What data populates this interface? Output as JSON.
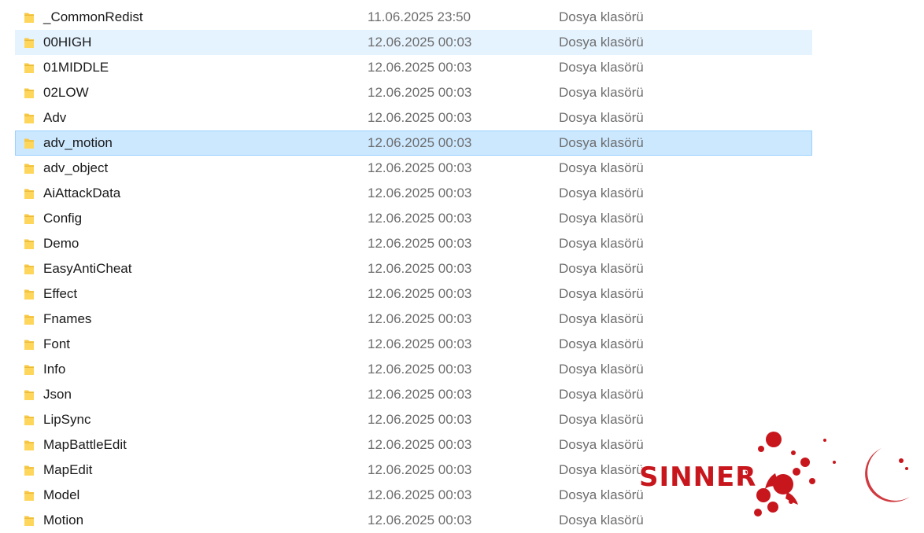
{
  "rows": [
    {
      "name": "_CommonRedist",
      "date": "11.06.2025 23:50",
      "type": "Dosya klasörü",
      "state": ""
    },
    {
      "name": "00HIGH",
      "date": "12.06.2025 00:03",
      "type": "Dosya klasörü",
      "state": "hover"
    },
    {
      "name": "01MIDDLE",
      "date": "12.06.2025 00:03",
      "type": "Dosya klasörü",
      "state": ""
    },
    {
      "name": "02LOW",
      "date": "12.06.2025 00:03",
      "type": "Dosya klasörü",
      "state": ""
    },
    {
      "name": "Adv",
      "date": "12.06.2025 00:03",
      "type": "Dosya klasörü",
      "state": ""
    },
    {
      "name": "adv_motion",
      "date": "12.06.2025 00:03",
      "type": "Dosya klasörü",
      "state": "selected"
    },
    {
      "name": "adv_object",
      "date": "12.06.2025 00:03",
      "type": "Dosya klasörü",
      "state": ""
    },
    {
      "name": "AiAttackData",
      "date": "12.06.2025 00:03",
      "type": "Dosya klasörü",
      "state": ""
    },
    {
      "name": "Config",
      "date": "12.06.2025 00:03",
      "type": "Dosya klasörü",
      "state": ""
    },
    {
      "name": "Demo",
      "date": "12.06.2025 00:03",
      "type": "Dosya klasörü",
      "state": ""
    },
    {
      "name": "EasyAntiCheat",
      "date": "12.06.2025 00:03",
      "type": "Dosya klasörü",
      "state": ""
    },
    {
      "name": "Effect",
      "date": "12.06.2025 00:03",
      "type": "Dosya klasörü",
      "state": ""
    },
    {
      "name": "Fnames",
      "date": "12.06.2025 00:03",
      "type": "Dosya klasörü",
      "state": ""
    },
    {
      "name": "Font",
      "date": "12.06.2025 00:03",
      "type": "Dosya klasörü",
      "state": ""
    },
    {
      "name": "Info",
      "date": "12.06.2025 00:03",
      "type": "Dosya klasörü",
      "state": ""
    },
    {
      "name": "Json",
      "date": "12.06.2025 00:03",
      "type": "Dosya klasörü",
      "state": ""
    },
    {
      "name": "LipSync",
      "date": "12.06.2025 00:03",
      "type": "Dosya klasörü",
      "state": ""
    },
    {
      "name": "MapBattleEdit",
      "date": "12.06.2025 00:03",
      "type": "Dosya klasörü",
      "state": ""
    },
    {
      "name": "MapEdit",
      "date": "12.06.2025 00:03",
      "type": "Dosya klasörü",
      "state": ""
    },
    {
      "name": "Model",
      "date": "12.06.2025 00:03",
      "type": "Dosya klasörü",
      "state": ""
    },
    {
      "name": "Motion",
      "date": "12.06.2025 00:03",
      "type": "Dosya klasörü",
      "state": ""
    }
  ],
  "icons": {
    "folder": "folder-icon"
  },
  "colors": {
    "selected_bg": "#cce8ff",
    "selected_border": "#99d1ff",
    "hover_bg": "#e5f3ff",
    "folder_yellow": "#ffd65c",
    "watermark_red": "#c8161d"
  },
  "watermark": {
    "text": "SINNER"
  }
}
